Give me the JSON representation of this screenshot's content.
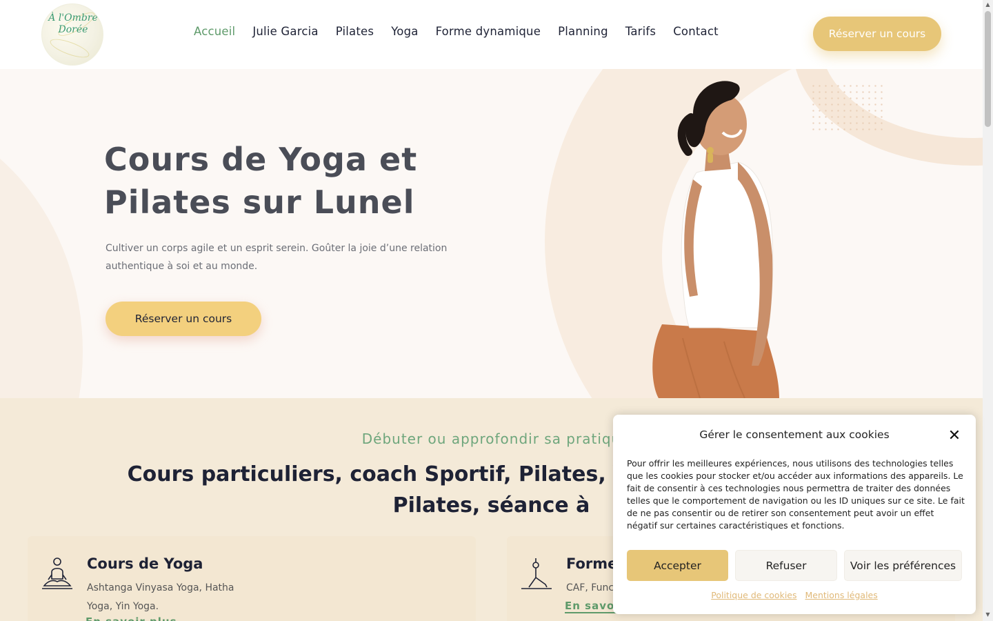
{
  "header": {
    "logo_text": "À l'Ombre Dorée",
    "nav": [
      {
        "label": "Accueil",
        "active": true
      },
      {
        "label": "Julie Garcia"
      },
      {
        "label": "Pilates"
      },
      {
        "label": "Yoga"
      },
      {
        "label": "Forme dynamique"
      },
      {
        "label": "Planning"
      },
      {
        "label": "Tarifs"
      },
      {
        "label": "Contact"
      }
    ],
    "cta_label": "Réserver un cours"
  },
  "hero": {
    "title": "Cours de Yoga et Pilates sur Lunel",
    "subtitle": "Cultiver un corps agile et un esprit serein. Goûter la joie d’une relation authentique à soi et au monde.",
    "cta_label": "Réserver un cours"
  },
  "services": {
    "kicker": "Débuter ou approfondir sa pratiqu",
    "title": "Cours particuliers, coach Sportif, Pilates, Yoga enceintes, rose Pilates, séance à",
    "cards": [
      {
        "title": "Cours de Yoga",
        "description": "Ashtanga Vinyasa Yoga, Hatha Yoga, Yin Yoga.",
        "link": "En savoir plus"
      },
      {
        "title": "Forme",
        "description": "CAF, Funct",
        "link": "En savoi"
      }
    ]
  },
  "cookie": {
    "title": "Gérer le consentement aux cookies",
    "text": "Pour offrir les meilleures expériences, nous utilisons des technologies telles que les cookies pour stocker et/ou accéder aux informations des appareils. Le fait de consentir à ces technologies nous permettra de traiter des données telles que le comportement de navigation ou les ID uniques sur ce site. Le fait de ne pas consentir ou de retirer son consentement peut avoir un effet négatif sur certaines caractéristiques et fonctions.",
    "accept": "Accepter",
    "refuse": "Refuser",
    "preferences": "Voir les préférences",
    "links": [
      "Politique de cookies",
      "Mentions légales"
    ]
  },
  "colors": {
    "accent_green": "#5e9a6a",
    "gold": "#e7c678",
    "hero_bg": "#fcf8f5",
    "section_bg": "#f4ead8"
  }
}
